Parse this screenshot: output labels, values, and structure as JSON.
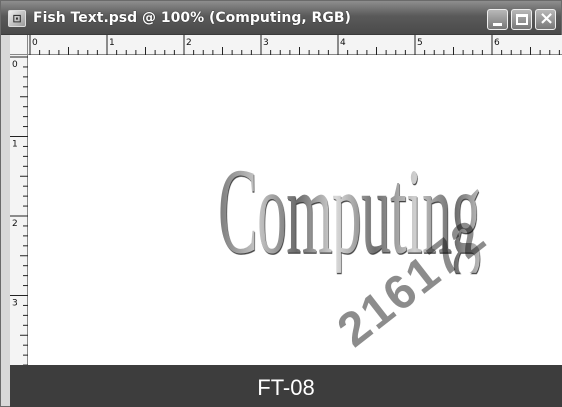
{
  "window": {
    "title": "Fish Text.psd @ 100% (Computing, RGB)",
    "icon": "photoshop-document-icon",
    "title_icon_glyph": "⊡"
  },
  "ruler": {
    "horizontal_labels": [
      "0",
      "1",
      "2",
      "3",
      "4",
      "5",
      "6"
    ],
    "vertical_labels": [
      "0",
      "1",
      "2",
      "3"
    ]
  },
  "canvas": {
    "text": "Computing"
  },
  "caption": {
    "label": "FT-08"
  },
  "watermark": {
    "text": "216172"
  },
  "colors": {
    "titlebar": "#555555",
    "caption_bar": "#3d3d3d",
    "canvas": "#ffffff"
  }
}
